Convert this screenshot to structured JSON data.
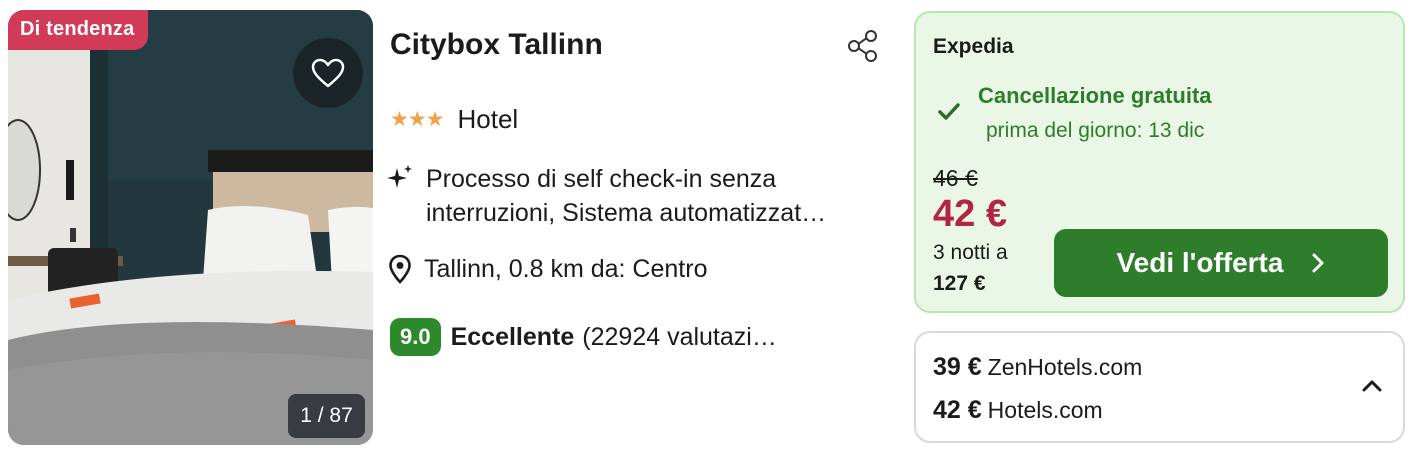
{
  "photo": {
    "badge": "Di tendenza",
    "counter": "1 / 87",
    "favorite_icon": "heart-outline-icon"
  },
  "hotel": {
    "name": "Citybox Tallinn",
    "stars": "★★★",
    "star_count": 3,
    "type": "Hotel",
    "amenities": "Processo di self check-in senza interruzioni, Sistema automatizzat…",
    "location": "Tallinn, 0.8 km da: Centro",
    "score": "9.0",
    "rating_label": "Eccellente",
    "rating_count": "(22924 valutazi…"
  },
  "offer": {
    "provider": "Expedia",
    "cancellation_title": "Cancellazione gratuita",
    "cancellation_sub": "prima del giorno: 13 dic",
    "old_price": "46 €",
    "price": "42 €",
    "nights_label": "3 notti a",
    "total": "127 €",
    "cta_label": "Vedi l'offerta"
  },
  "other_offers": [
    {
      "price": "39 €",
      "site": "ZenHotels.com"
    },
    {
      "price": "42 €",
      "site": "Hotels.com"
    }
  ],
  "colors": {
    "badge": "#d23b57",
    "score": "#2c8a2c",
    "price": "#b2263f",
    "cta": "#2e7d2a",
    "offer_bg": "#eaf7e6",
    "stars": "#f0a24a"
  }
}
